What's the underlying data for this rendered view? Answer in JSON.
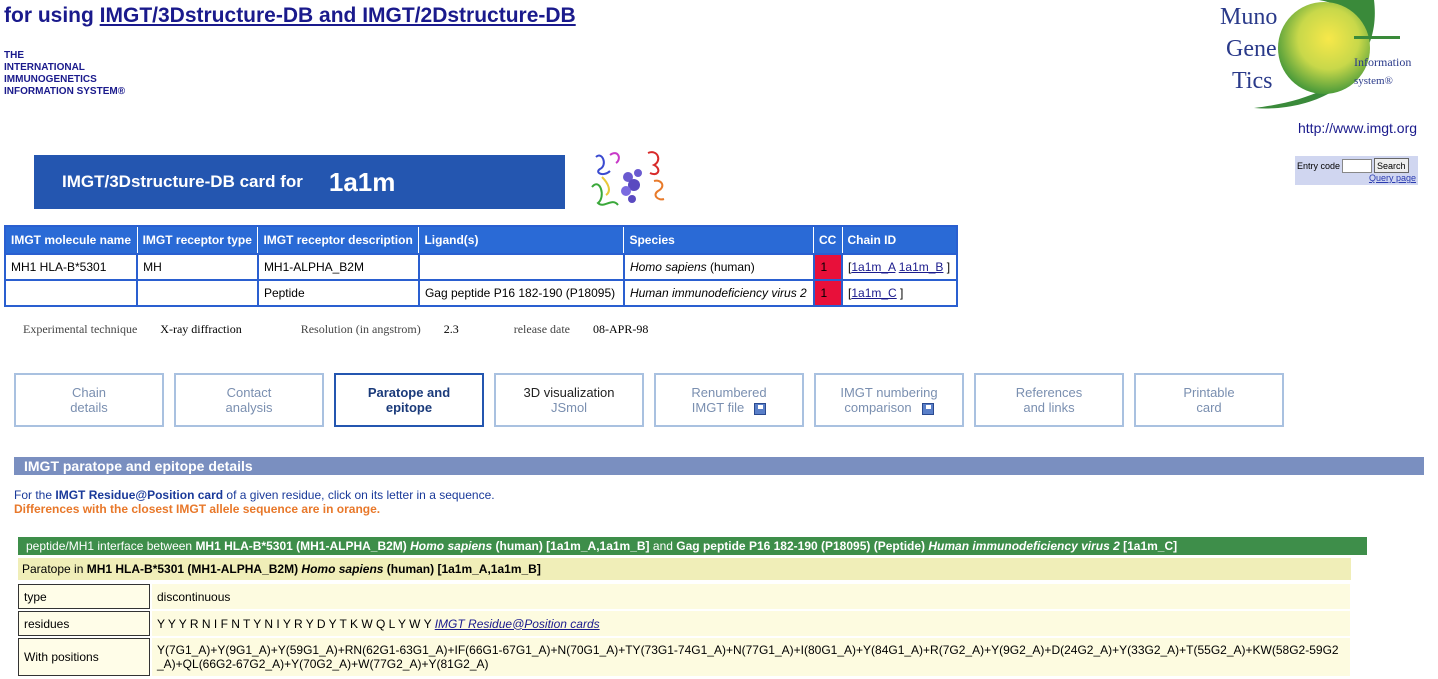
{
  "header": {
    "title_prefix": "for using ",
    "title_link": "IMGT/3Dstructure-DB and IMGT/2Dstructure-DB",
    "org_line1": "THE",
    "org_line2": "INTERNATIONAL",
    "org_line3": "IMMUNOGENETICS",
    "org_line4": "INFORMATION SYSTEM®",
    "logo_word1": "Muno",
    "logo_word2": "Gene",
    "logo_word3": "Tics",
    "logo_info1": "Information",
    "logo_info2": "system®",
    "url": "http://www.imgt.org"
  },
  "search": {
    "label": "Entry code",
    "button": "Search",
    "query_link": "Query page"
  },
  "card": {
    "label": "IMGT/3Dstructure-DB card for",
    "code": "1a1m"
  },
  "summary": {
    "headers": [
      "IMGT molecule name",
      "IMGT receptor type",
      "IMGT receptor description",
      "Ligand(s)",
      "Species",
      "CC",
      "Chain ID"
    ],
    "rows": [
      {
        "molecule": "MH1 HLA-B*5301",
        "receptor_type": "MH",
        "description": "MH1-ALPHA_B2M",
        "ligand": "",
        "species_italic": "Homo sapiens",
        "species_rest": " (human)",
        "cc": "1",
        "chain_open": "[",
        "chains": [
          "1a1m_A",
          "1a1m_B"
        ],
        "chain_close": " ]"
      },
      {
        "molecule": "",
        "receptor_type": "",
        "description": "Peptide",
        "ligand": "Gag peptide P16 182-190 (P18095)",
        "species_italic": "Human immunodeficiency virus 2",
        "species_rest": "",
        "cc": "1",
        "chain_open": "[",
        "chains": [
          "1a1m_C"
        ],
        "chain_close": " ]"
      }
    ]
  },
  "experiment": {
    "technique_label": "Experimental technique",
    "technique_value": "X-ray diffraction",
    "resolution_label": "Resolution (in angstrom)",
    "resolution_value": "2.3",
    "release_label": "release date",
    "release_value": "08-APR-98"
  },
  "tabs": [
    {
      "line1": "Chain",
      "line2": "details"
    },
    {
      "line1": "Contact",
      "line2": "analysis"
    },
    {
      "line1": "Paratope and",
      "line2": "epitope"
    },
    {
      "line1": "3D visualization",
      "line2": "JSmol"
    },
    {
      "line1": "Renumbered",
      "line2": "IMGT file"
    },
    {
      "line1": "IMGT numbering",
      "line2": "comparison"
    },
    {
      "line1": "References",
      "line2": "and links"
    },
    {
      "line1": "Printable",
      "line2": "card"
    }
  ],
  "section": {
    "title": "IMGT paratope and epitope details",
    "note1_prefix": "For the ",
    "note1_bold": "IMGT Residue@Position card",
    "note1_suffix": " of a given residue, click on its letter in a sequence.",
    "note2": "Differences with the closest IMGT allele sequence are in orange."
  },
  "interface": {
    "prefix": "peptide/MH1 interface between ",
    "b1": "MH1 HLA-B*5301 (MH1-ALPHA_B2M) ",
    "i1": "Homo sapiens",
    "b2": " (human) [1a1m_A,1a1m_B]",
    "mid": " and ",
    "b3": "Gag peptide P16 182-190 (P18095) (Peptide) ",
    "i2": "Human immunodeficiency virus 2",
    "b4": " [1a1m_C]"
  },
  "paratope": {
    "prefix": "Paratope in ",
    "b1": "MH1 HLA-B*5301 (MH1-ALPHA_B2M) ",
    "i1": "Homo sapiens",
    "b2": " (human) [1a1m_A,1a1m_B]"
  },
  "details": {
    "type_label": "type",
    "type_value": "discontinuous",
    "residues_label": "residues",
    "residues_value": "Y Y Y R N I F N T Y N I Y R Y D Y T K W Q L Y W Y ",
    "residues_link": "IMGT Residue@Position cards",
    "positions_label": "With positions",
    "positions_value": "Y(7G1_A)+Y(9G1_A)+Y(59G1_A)+RN(62G1-63G1_A)+IF(66G1-67G1_A)+N(70G1_A)+TY(73G1-74G1_A)+N(77G1_A)+I(80G1_A)+Y(84G1_A)+R(7G2_A)+Y(9G2_A)+D(24G2_A)+Y(33G2_A)+T(55G2_A)+KW(58G2-59G2_A)+QL(66G2-67G2_A)+Y(70G2_A)+W(77G2_A)+Y(81G2_A)"
  },
  "colors": {
    "banner": "#2456b0",
    "table_header": "#2a6ad6",
    "cc_red": "#e8103a",
    "section_header": "#7a8fc0",
    "interface_green": "#3e8e4a",
    "paratope_yellow": "#f0eeb8",
    "orange_note": "#e8782a"
  }
}
